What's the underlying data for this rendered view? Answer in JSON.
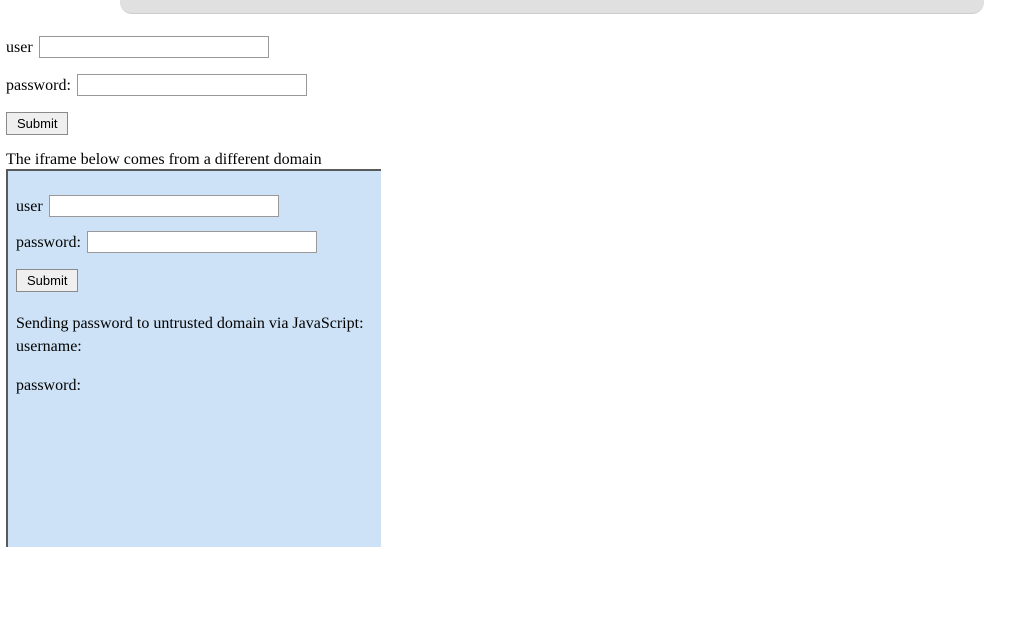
{
  "main": {
    "user_label": "user",
    "password_label": "password:",
    "user_value": "",
    "password_value": "",
    "submit_label": "Submit"
  },
  "iframe_caption": "The iframe below comes from a different domain",
  "iframe": {
    "user_label": "user",
    "password_label": "password:",
    "user_value": "",
    "password_value": "",
    "submit_label": "Submit",
    "status_heading": "Sending password to untrusted domain via JavaScript:",
    "status_username": "username:",
    "status_password": "password:"
  }
}
